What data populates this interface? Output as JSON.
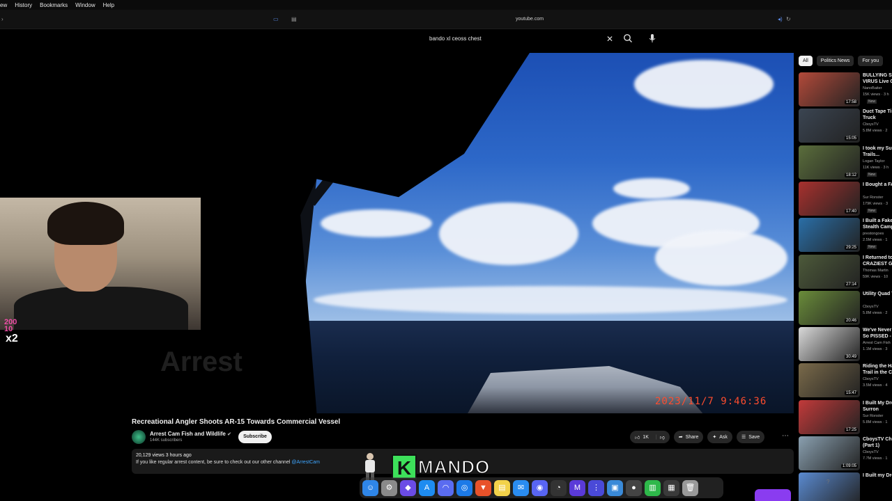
{
  "menubar": {
    "items": [
      "ew",
      "History",
      "Bookmarks",
      "Window",
      "Help"
    ]
  },
  "browser": {
    "url": "youtube.com"
  },
  "search": {
    "query": "bando xl ceoss chest"
  },
  "video": {
    "timestamp": "2023/11/7   9:46:36",
    "watermark": "Arrest",
    "title": "Recreational Angler Shoots AR-15 Towards Commercial Vessel",
    "channel": "Arrest Cam Fish and Wildlife",
    "subscribers": "144K subscribers",
    "subscribe_label": "Subscribe",
    "likes": "1K",
    "share_label": "Share",
    "ask_label": "Ask",
    "save_label": "Save",
    "views_meta": "20,129 views  3 hours ago",
    "description": "If you like regular arrest content, be sure to check out our other channel ",
    "description_link": "@ArrestCam"
  },
  "stream_overlay": {
    "sub_count": "200\n10",
    "multiplier": "x2",
    "logo_k": "K",
    "logo_word": "MANDO"
  },
  "sidebar": {
    "chips": [
      "All",
      "Politics News",
      "For you"
    ],
    "recommendations": [
      {
        "title": "BULLYING Sc",
        "title2": "VIRUS Live O",
        "channel": "NanoBaiter",
        "views": "15K views · 3 h",
        "duration": "17:58",
        "badge": "New",
        "color": "#b34a3a"
      },
      {
        "title": "Duct Tape Ti",
        "title2": "Truck",
        "channel": "CboysTV",
        "views": "5.8M views · 2",
        "duration": "15:05",
        "badge": "",
        "color": "#3b4552"
      },
      {
        "title": "I took my Su",
        "title2": "Trails...",
        "channel": "Logan Taylor",
        "views": "11K views · 3 h",
        "duration": "18:12",
        "badge": "New",
        "color": "#5b6e3c"
      },
      {
        "title": "I Bought a FA",
        "title2": "",
        "channel": "Sur Ronster",
        "views": "179K views · 3",
        "duration": "17:40",
        "badge": "New",
        "color": "#a8312e"
      },
      {
        "title": "I Built a Fake",
        "title2": "Stealth Camp",
        "channel": "prestongoes",
        "views": "2.5M views · 1",
        "duration": "29:25",
        "badge": "New",
        "color": "#2a6fa8"
      },
      {
        "title": "I Returned to",
        "title2": "CRAZIEST Gr",
        "channel": "Thomas Martin",
        "views": "59K views · 10",
        "duration": "27:14",
        "badge": "",
        "color": "#4d5a3a"
      },
      {
        "title": "Utility Quad T",
        "title2": "",
        "channel": "CboysTV",
        "views": "5.8M views · 2",
        "duration": "20:46",
        "badge": "",
        "color": "#6a8c3a"
      },
      {
        "title": "We've Never",
        "title2": "So PISSED - (",
        "channel": "Arrest Cam Fish",
        "views": "1.1M views · 3",
        "duration": "30:49",
        "badge": "",
        "color": "#d9d9d9"
      },
      {
        "title": "Riding the Ha",
        "title2": "Trail in the Ce",
        "channel": "CboysTV",
        "views": "3.5M views · 4",
        "duration": "15:47",
        "badge": "",
        "color": "#7a6a4a"
      },
      {
        "title": "I Built My Dre",
        "title2": "Surron",
        "channel": "Sur Ronster",
        "views": "5.8M views · 1",
        "duration": "17:25",
        "badge": "",
        "color": "#c23a3a"
      },
      {
        "title": "CboysTV Ch",
        "title2": "(Part 1)",
        "channel": "CboysTV",
        "views": "7.7M views · 1",
        "duration": "1:09:05",
        "badge": "",
        "color": "#8aa0b0"
      },
      {
        "title": "I Built my Dre",
        "title2": "",
        "channel": "",
        "views": "",
        "duration": "",
        "badge": "",
        "color": "#5a8ad0"
      }
    ]
  },
  "dock": {
    "icons": [
      {
        "name": "finder-icon",
        "color": "#2f86e8",
        "glyph": "☺"
      },
      {
        "name": "settings-icon",
        "color": "#8a8a8a",
        "glyph": "⚙"
      },
      {
        "name": "proton-icon",
        "color": "#6b4ce6",
        "glyph": "◆"
      },
      {
        "name": "app-store-icon",
        "color": "#1e8cf0",
        "glyph": "A"
      },
      {
        "name": "arc-icon",
        "color": "#5a6cf0",
        "glyph": "◠"
      },
      {
        "name": "safari-icon",
        "color": "#1c7ae8",
        "glyph": "◎"
      },
      {
        "name": "brave-icon",
        "color": "#e8522a",
        "glyph": "▼"
      },
      {
        "name": "notes-icon",
        "color": "#f2d24a",
        "glyph": "▤"
      },
      {
        "name": "mail-icon",
        "color": "#2a8cf0",
        "glyph": "✉"
      },
      {
        "name": "discord-icon",
        "color": "#5865f2",
        "glyph": "◉"
      },
      {
        "name": "activity-icon",
        "color": "#333333",
        "glyph": "◔"
      },
      {
        "name": "mew-icon",
        "color": "#5a3ad8",
        "glyph": "M"
      },
      {
        "name": "launchpad-icon",
        "color": "#4a4ad8",
        "glyph": "⋮"
      },
      {
        "name": "finder2-icon",
        "color": "#3a8ad8",
        "glyph": "▣"
      },
      {
        "name": "obs-icon",
        "color": "#444444",
        "glyph": "●"
      },
      {
        "name": "numbers-icon",
        "color": "#2eb84a",
        "glyph": "▥"
      },
      {
        "name": "tools-icon",
        "color": "#3a3a3a",
        "glyph": "▦"
      },
      {
        "name": "trash-icon",
        "color": "#9a9a9a",
        "glyph": "🗑"
      }
    ]
  },
  "colors": {
    "accent": "#3ea6ff",
    "timestamp": "#ff4d2e",
    "logo": "#3de05a"
  }
}
